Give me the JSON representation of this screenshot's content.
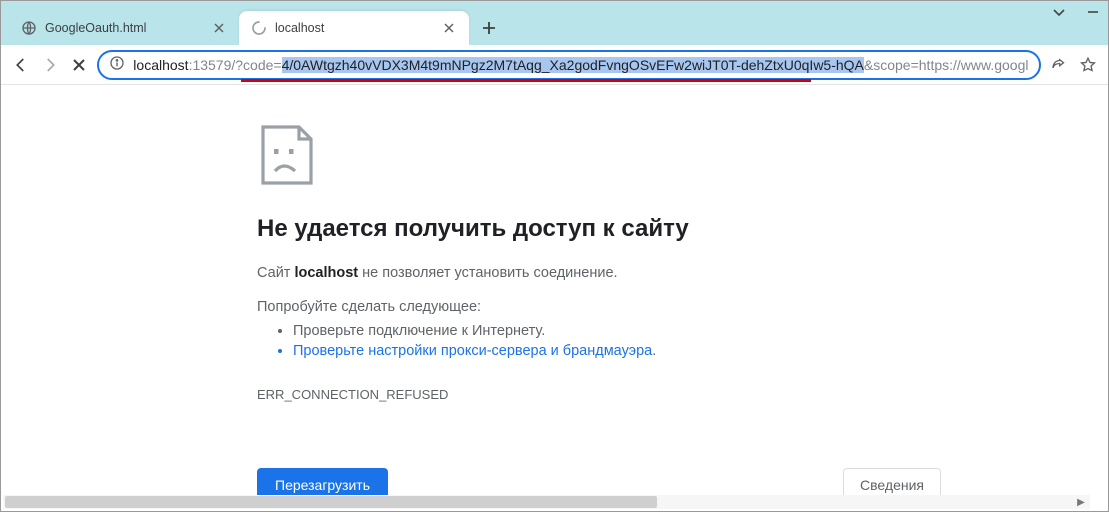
{
  "window_controls": {
    "chevron": "⌄",
    "minimize": "—"
  },
  "tabs": {
    "inactive": {
      "title": "GoogleOauth.html"
    },
    "active": {
      "title": "localhost"
    }
  },
  "url": {
    "host": "localhost",
    "port_and_path": ":13579/?code=",
    "selected_code": "4/0AWtgzh40vVDX3M4t9mNPgz2M7tAqg_Xa2godFvngOSvEFw2wiJT0T-dehZtxU0qIw5-hQA",
    "rest": "&scope=https://www.googl"
  },
  "error": {
    "title": "Не удается получить доступ к сайту",
    "line1_a": "Сайт ",
    "line1_b": "localhost",
    "line1_c": " не позволяет установить соединение.",
    "try_label": "Попробуйте сделать следующее:",
    "bullet1": "Проверьте подключение к Интернету.",
    "bullet2_link": "Проверьте настройки прокси-сервера и брандмауэра",
    "bullet2_suffix": ".",
    "code": "ERR_CONNECTION_REFUSED",
    "reload_btn": "Перезагрузить",
    "details_btn": "Сведения"
  }
}
